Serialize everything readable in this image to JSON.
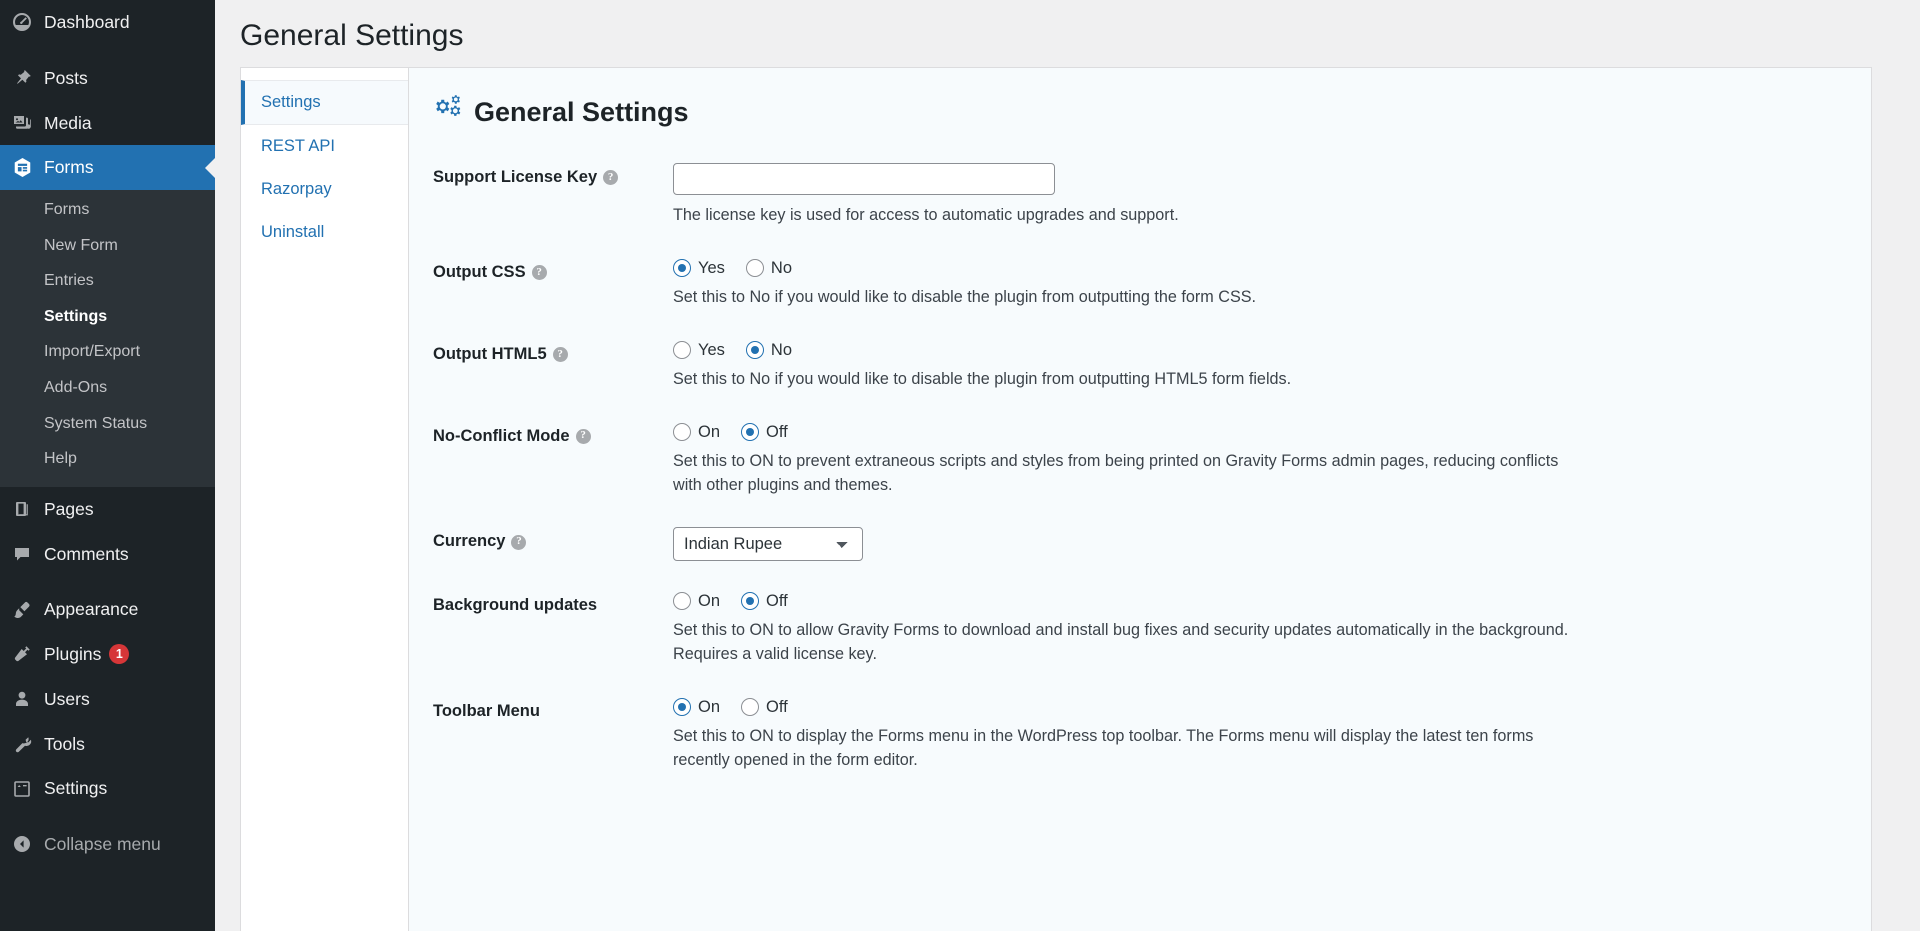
{
  "sidebar": {
    "items": [
      {
        "label": "Dashboard",
        "icon": "dashboard-icon"
      },
      {
        "label": "Posts",
        "icon": "pin-icon"
      },
      {
        "label": "Media",
        "icon": "media-icon"
      },
      {
        "label": "Forms",
        "icon": "forms-icon"
      },
      {
        "label": "Pages",
        "icon": "pages-icon"
      },
      {
        "label": "Comments",
        "icon": "comments-icon"
      },
      {
        "label": "Appearance",
        "icon": "brush-icon"
      },
      {
        "label": "Plugins",
        "icon": "plug-icon",
        "badge": "1"
      },
      {
        "label": "Users",
        "icon": "user-icon"
      },
      {
        "label": "Tools",
        "icon": "wrench-icon"
      },
      {
        "label": "Settings",
        "icon": "sliders-icon"
      },
      {
        "label": "Collapse menu",
        "icon": "collapse-arrow-icon"
      }
    ],
    "forms_submenu": [
      {
        "label": "Forms"
      },
      {
        "label": "New Form"
      },
      {
        "label": "Entries"
      },
      {
        "label": "Settings"
      },
      {
        "label": "Import/Export"
      },
      {
        "label": "Add-Ons"
      },
      {
        "label": "System Status"
      },
      {
        "label": "Help"
      }
    ],
    "active_top": "Forms",
    "active_sub": "Settings",
    "accent_color": "#2271b1",
    "badge_color": "#d63638"
  },
  "page": {
    "title": "General Settings"
  },
  "tabs": [
    {
      "label": "Settings",
      "active": true
    },
    {
      "label": "REST API",
      "active": false
    },
    {
      "label": "Razorpay",
      "active": false
    },
    {
      "label": "Uninstall",
      "active": false
    }
  ],
  "panel": {
    "heading": "General Settings",
    "heading_icon": "gears-icon",
    "fields": [
      {
        "label": "Support License Key",
        "has_help": true,
        "type": "text",
        "value": "",
        "placeholder": "",
        "description": "The license key is used for access to automatic upgrades and support."
      },
      {
        "label": "Output CSS",
        "has_help": true,
        "type": "radio",
        "options": [
          "Yes",
          "No"
        ],
        "selected": "Yes",
        "description": "Set this to No if you would like to disable the plugin from outputting the form CSS."
      },
      {
        "label": "Output HTML5",
        "has_help": true,
        "type": "radio",
        "options": [
          "Yes",
          "No"
        ],
        "selected": "No",
        "description": "Set this to No if you would like to disable the plugin from outputting HTML5 form fields."
      },
      {
        "label": "No-Conflict Mode",
        "has_help": true,
        "type": "radio",
        "options": [
          "On",
          "Off"
        ],
        "selected": "Off",
        "description": "Set this to ON to prevent extraneous scripts and styles from being printed on Gravity Forms admin pages, reducing conflicts with other plugins and themes."
      },
      {
        "label": "Currency",
        "has_help": true,
        "type": "select",
        "value": "Indian Rupee",
        "options": [
          "Indian Rupee"
        ],
        "description": ""
      },
      {
        "label": "Background updates",
        "has_help": false,
        "type": "radio",
        "options": [
          "On",
          "Off"
        ],
        "selected": "Off",
        "description": "Set this to ON to allow Gravity Forms to download and install bug fixes and security updates automatically in the background. Requires a valid license key."
      },
      {
        "label": "Toolbar Menu",
        "has_help": false,
        "type": "radio",
        "options": [
          "On",
          "Off"
        ],
        "selected": "On",
        "description": "Set this to ON to display the Forms menu in the WordPress top toolbar. The Forms menu will display the latest ten forms recently opened in the form editor."
      }
    ]
  }
}
